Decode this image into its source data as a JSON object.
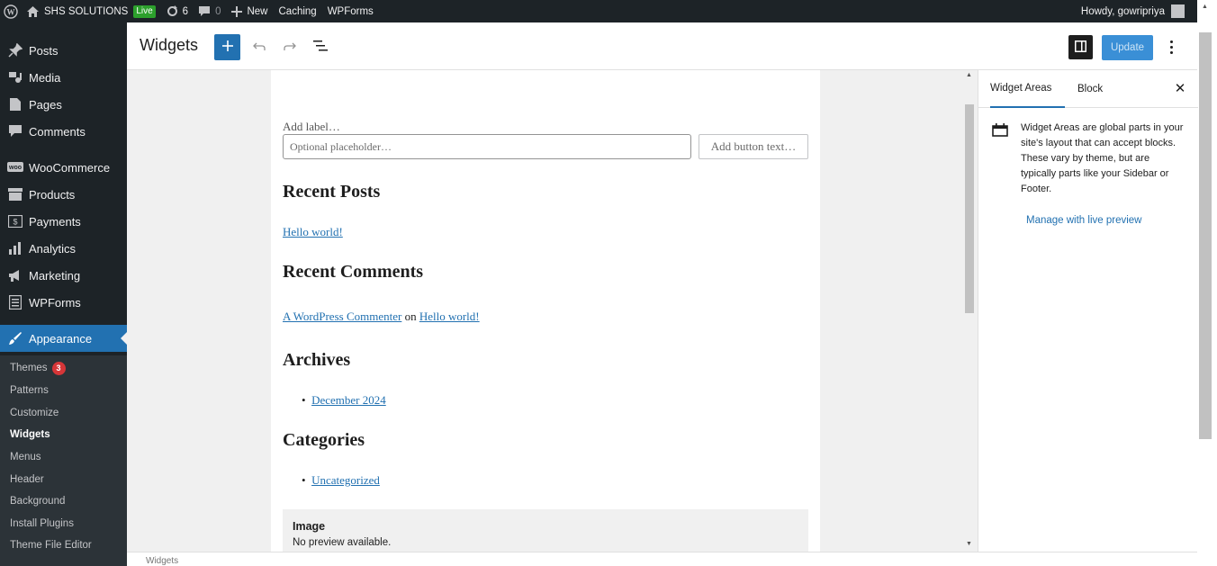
{
  "admin_bar": {
    "site_name": "SHS SOLUTIONS",
    "live_badge": "Live",
    "updates_count": "6",
    "comments_count": "0",
    "new_label": "New",
    "caching_label": "Caching",
    "wpforms_label": "WPForms",
    "greeting": "Howdy, gowripriya"
  },
  "sidebar": {
    "items": [
      {
        "label": "Posts",
        "icon": "pin-icon"
      },
      {
        "label": "Media",
        "icon": "media-icon"
      },
      {
        "label": "Pages",
        "icon": "page-icon"
      },
      {
        "label": "Comments",
        "icon": "comment-icon"
      },
      {
        "label": "WooCommerce",
        "icon": "woocommerce-icon"
      },
      {
        "label": "Products",
        "icon": "archive-icon"
      },
      {
        "label": "Payments",
        "icon": "payments-icon"
      },
      {
        "label": "Analytics",
        "icon": "bar-chart-icon"
      },
      {
        "label": "Marketing",
        "icon": "megaphone-icon"
      },
      {
        "label": "WPForms",
        "icon": "form-icon"
      },
      {
        "label": "Appearance",
        "icon": "brush-icon"
      }
    ],
    "submenu": [
      {
        "label": "Themes",
        "badge": "3"
      },
      {
        "label": "Patterns"
      },
      {
        "label": "Customize"
      },
      {
        "label": "Widgets"
      },
      {
        "label": "Menus"
      },
      {
        "label": "Header"
      },
      {
        "label": "Background"
      },
      {
        "label": "Install Plugins"
      },
      {
        "label": "Theme File Editor"
      }
    ]
  },
  "header": {
    "title": "Widgets",
    "update_label": "Update"
  },
  "canvas": {
    "search_label": "Add label…",
    "search_placeholder": "Optional placeholder…",
    "search_button": "Add button text…",
    "recent_posts_heading": "Recent Posts",
    "recent_post_link": "Hello world!",
    "recent_comments_heading": "Recent Comments",
    "comment_author": "A WordPress Commenter",
    "comment_on": "on",
    "comment_post": "Hello world!",
    "archives_heading": "Archives",
    "archive_item": "December 2024",
    "categories_heading": "Categories",
    "category_item": "Uncategorized",
    "image_block_title": "Image",
    "image_block_text": "No preview available."
  },
  "settings": {
    "tab_widget_areas": "Widget Areas",
    "tab_block": "Block",
    "description": "Widget Areas are global parts in your site's layout that can accept blocks. These vary by theme, but are typically parts like your Sidebar or Footer.",
    "manage_link": "Manage with live preview"
  },
  "footer": {
    "breadcrumb": "Widgets"
  },
  "colors": {
    "admin_dark": "#1d2327",
    "accent": "#2271b1",
    "submenu_bg": "#2c3338",
    "badge_red": "#d63638"
  }
}
